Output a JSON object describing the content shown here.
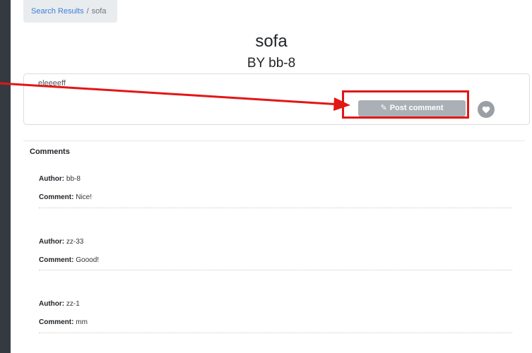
{
  "breadcrumb": {
    "link": "Search Results",
    "separator": "/",
    "current": "sofa"
  },
  "post": {
    "title": "sofa",
    "byline": "BY bb-8",
    "body": "eleeeeff"
  },
  "actions": {
    "post_comment_label": "Post comment",
    "pencil_icon": "pencil-icon",
    "heart_icon": "heart-icon"
  },
  "comments_section": {
    "heading": "Comments",
    "author_label": "Author:",
    "comment_label": "Comment:",
    "items": [
      {
        "author": "bb-8",
        "comment": "Nice!"
      },
      {
        "author": "zz-33",
        "comment": "Goood!"
      },
      {
        "author": "zz-1",
        "comment": "mm"
      }
    ]
  },
  "colors": {
    "highlight": "#e31616",
    "rail": "#343a40",
    "button": "#aab0b6"
  }
}
